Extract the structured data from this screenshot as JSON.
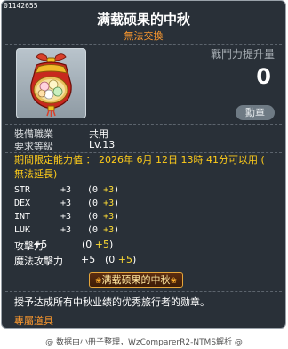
{
  "serial": "01142655",
  "item": {
    "name": "满载硕果的中秋",
    "trade_status": "無法交換",
    "icon": "mooncake-gift-bag-icon"
  },
  "combat_power": {
    "label": "戰鬥力提升量",
    "value": "0"
  },
  "equip_button": "勳章",
  "requirements": {
    "job_label": "裝備職業",
    "job_value": "共用",
    "level_label": "要求等級",
    "level_value": "Lv.13"
  },
  "period": {
    "text": "期間限定能力值 ： 2026年 6月 12日 13時 41分可以用 (",
    "text2": "無法延長)"
  },
  "stats": [
    {
      "name": "STR",
      "total": "+3",
      "base": "(0 ",
      "bonus": "+3",
      "close": ")"
    },
    {
      "name": "DEX",
      "total": "+3",
      "base": "(0 ",
      "bonus": "+3",
      "close": ")"
    },
    {
      "name": "INT",
      "total": "+3",
      "base": "(0 ",
      "bonus": "+3",
      "close": ")"
    },
    {
      "name": "LUK",
      "total": "+3",
      "base": "(0 ",
      "bonus": "+3",
      "close": ")"
    }
  ],
  "stats2": [
    {
      "name": "攻擊力",
      "total": "+5",
      "base": "(0 ",
      "bonus": "+5",
      "close": ")"
    },
    {
      "name": "魔法攻擊力",
      "total": "+5",
      "base": "(0 ",
      "bonus": "+5",
      "close": ")"
    }
  ],
  "medal_badge": "满载硕果的中秋",
  "description": "授予达成所有中秋业绩的优秀旅行者的勋章。",
  "tag": "專屬道具",
  "footer": "@ 数据由小册子整理，WzComparerR2-NTMS解析 @",
  "colors": {
    "panel": "#293038",
    "trade": "#ff9a2e",
    "period": "#ffcc1a",
    "bonus": "#ffdd33"
  }
}
